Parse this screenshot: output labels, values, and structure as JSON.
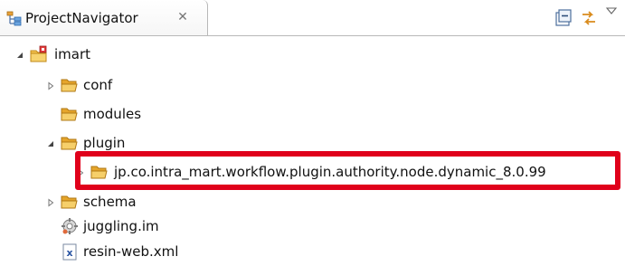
{
  "view": {
    "title": "ProjectNavigator",
    "close_glyph": "✕",
    "title_icon": "project-navigator-icon",
    "toolbar": [
      {
        "name": "collapse-all",
        "icon": "collapse-all-icon"
      },
      {
        "name": "link-with-editor",
        "icon": "link-with-editor-icon"
      },
      {
        "name": "view-menu",
        "icon": "view-menu-icon"
      }
    ]
  },
  "tree": [
    {
      "label": "imart",
      "icon": "project-icon",
      "expanded": true
    },
    {
      "label": "conf",
      "icon": "folder-icon",
      "expanded": false
    },
    {
      "label": "modules",
      "icon": "folder-icon"
    },
    {
      "label": "plugin",
      "icon": "folder-icon",
      "expanded": true
    },
    {
      "label": "jp.co.intra_mart.workflow.plugin.authority.node.dynamic_8.0.99",
      "icon": "folder-icon",
      "expanded": false
    },
    {
      "label": "schema",
      "icon": "folder-icon",
      "expanded": false
    },
    {
      "label": "juggling.im",
      "icon": "juggling-file-icon"
    },
    {
      "label": "resin-web.xml",
      "icon": "xml-file-icon"
    }
  ],
  "highlight": {
    "target": "jp.co.intra_mart.workflow.plugin.authority.node.dynamic_8.0.99",
    "color": "#e0001b"
  },
  "colors": {
    "folder": "#f2b32c",
    "folder_dark": "#c98a12",
    "project": "#e84a4a",
    "twisty": "#555555"
  }
}
